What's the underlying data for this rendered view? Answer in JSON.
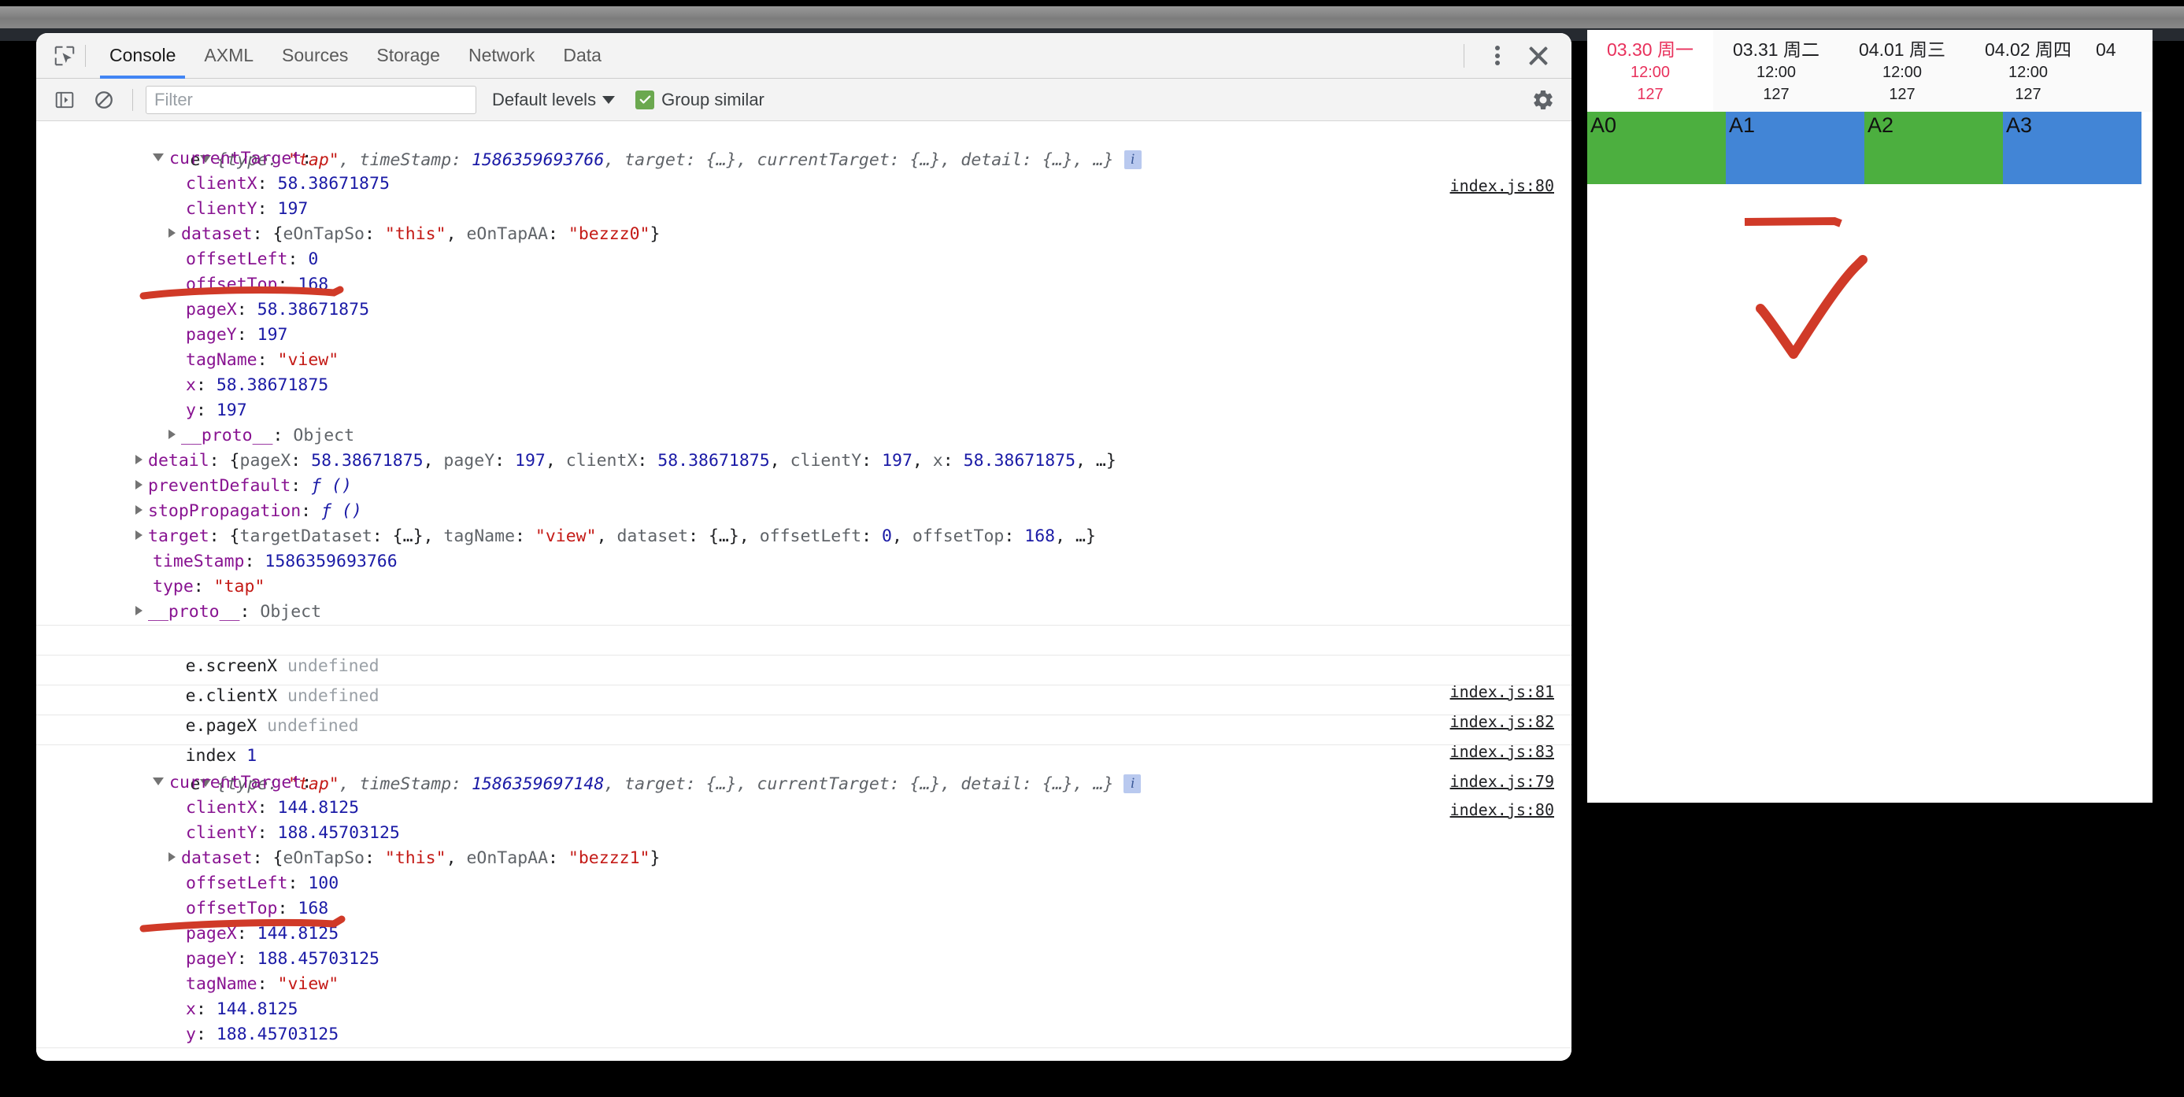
{
  "window": {
    "tabstrip": {
      "inspect_icon": "inspect-cursor-icon",
      "tabs": [
        {
          "label": "Console",
          "active": true
        },
        {
          "label": "AXML",
          "active": false
        },
        {
          "label": "Sources",
          "active": false
        },
        {
          "label": "Storage",
          "active": false
        },
        {
          "label": "Network",
          "active": false
        },
        {
          "label": "Data",
          "active": false
        }
      ],
      "more_icon": "kebab-menu-icon",
      "close_icon": "close-icon"
    },
    "toolbar": {
      "sidebar_icon": "show-console-sidebar-icon",
      "clear_icon": "clear-console-icon",
      "filter_placeholder": "Filter",
      "filter_value": "",
      "levels_label": "Default levels",
      "levels_caret": "chevron-down-icon",
      "group_similar_label": "Group similar",
      "group_similar_checked": true,
      "settings_icon": "gear-icon"
    }
  },
  "console": {
    "entries": [
      {
        "id": "entry-1",
        "source": "index.js:80",
        "header": {
          "var": "e",
          "preview": "{type: \"tap\", timeStamp: 1586359693766, target: {…}, currentTarget: {…}, detail: {…}, …}",
          "type_value": "\"tap\"",
          "timestamp_value": "1586359693766",
          "badge": "i"
        },
        "rows": [
          {
            "indent": 1,
            "arrow": "open",
            "key": "currentTarget",
            "sep": ":",
            "value": "",
            "vtype": "none"
          },
          {
            "indent": 2,
            "arrow": "none",
            "key": "clientX",
            "sep": ": ",
            "value": "58.38671875",
            "vtype": "num"
          },
          {
            "indent": 2,
            "arrow": "none",
            "key": "clientY",
            "sep": ": ",
            "value": "197",
            "vtype": "num"
          },
          {
            "indent": 2,
            "arrow": "closed",
            "key": "dataset",
            "sep": ": ",
            "value": "{eOnTapSo: \"this\", eOnTapAA: \"bezzz0\"}",
            "vtype": "objpreview",
            "strings": [
              "\"this\"",
              "\"bezzz0\""
            ]
          },
          {
            "indent": 2,
            "arrow": "none",
            "key": "offsetLeft",
            "sep": ": ",
            "value": "0",
            "vtype": "num"
          },
          {
            "indent": 2,
            "arrow": "none",
            "key": "offsetTop",
            "sep": ": ",
            "value": "168",
            "vtype": "num",
            "annotated": true
          },
          {
            "indent": 2,
            "arrow": "none",
            "key": "pageX",
            "sep": ": ",
            "value": "58.38671875",
            "vtype": "num"
          },
          {
            "indent": 2,
            "arrow": "none",
            "key": "pageY",
            "sep": ": ",
            "value": "197",
            "vtype": "num"
          },
          {
            "indent": 2,
            "arrow": "none",
            "key": "tagName",
            "sep": ": ",
            "value": "\"view\"",
            "vtype": "str"
          },
          {
            "indent": 2,
            "arrow": "none",
            "key": "x",
            "sep": ": ",
            "value": "58.38671875",
            "vtype": "num"
          },
          {
            "indent": 2,
            "arrow": "none",
            "key": "y",
            "sep": ": ",
            "value": "197",
            "vtype": "num"
          },
          {
            "indent": 2,
            "arrow": "closed",
            "key": "__proto__",
            "sep": ": ",
            "value": "Object",
            "vtype": "gray"
          },
          {
            "indent": 1,
            "arrow": "closed",
            "key": "detail",
            "sep": ": ",
            "value": "{pageX: 58.38671875, pageY: 197, clientX: 58.38671875, clientY: 197, x: 58.38671875, …}",
            "vtype": "objpreview"
          },
          {
            "indent": 1,
            "arrow": "closed",
            "key": "preventDefault",
            "sep": ": ",
            "value": "ƒ ()",
            "vtype": "fn"
          },
          {
            "indent": 1,
            "arrow": "closed",
            "key": "stopPropagation",
            "sep": ": ",
            "value": "ƒ ()",
            "vtype": "fn"
          },
          {
            "indent": 1,
            "arrow": "closed",
            "key": "target",
            "sep": ": ",
            "value": "{targetDataset: {…}, tagName: \"view\", dataset: {…}, offsetLeft: 0, offsetTop: 168, …}",
            "vtype": "objpreview"
          },
          {
            "indent": 1,
            "arrow": "none",
            "key": "timeStamp",
            "sep": ": ",
            "value": "1586359693766",
            "vtype": "num"
          },
          {
            "indent": 1,
            "arrow": "none",
            "key": "type",
            "sep": ": ",
            "value": "\"tap\"",
            "vtype": "str"
          },
          {
            "indent": 1,
            "arrow": "closed",
            "key": "__proto__",
            "sep": ": ",
            "value": "Object",
            "vtype": "gray"
          }
        ]
      },
      {
        "id": "entry-2",
        "simple": true,
        "label": "e.screenX",
        "value": "undefined",
        "source": "index.js:81"
      },
      {
        "id": "entry-3",
        "simple": true,
        "label": "e.clientX",
        "value": "undefined",
        "source": "index.js:82"
      },
      {
        "id": "entry-4",
        "simple": true,
        "label": "e.pageX",
        "value": "undefined",
        "source": "index.js:83"
      },
      {
        "id": "entry-5",
        "simple": true,
        "label": "index",
        "value": "1",
        "vtype": "num",
        "source": "index.js:79"
      },
      {
        "id": "entry-6",
        "source": "index.js:80",
        "header": {
          "var": "e",
          "preview": "{type: \"tap\", timeStamp: 1586359697148, target: {…}, currentTarget: {…}, detail: {…}, …}",
          "type_value": "\"tap\"",
          "timestamp_value": "1586359697148",
          "badge": "i"
        },
        "rows": [
          {
            "indent": 1,
            "arrow": "open",
            "key": "currentTarget",
            "sep": ":",
            "value": "",
            "vtype": "none"
          },
          {
            "indent": 2,
            "arrow": "none",
            "key": "clientX",
            "sep": ": ",
            "value": "144.8125",
            "vtype": "num"
          },
          {
            "indent": 2,
            "arrow": "none",
            "key": "clientY",
            "sep": ": ",
            "value": "188.45703125",
            "vtype": "num"
          },
          {
            "indent": 2,
            "arrow": "closed",
            "key": "dataset",
            "sep": ": ",
            "value": "{eOnTapSo: \"this\", eOnTapAA: \"bezzz1\"}",
            "vtype": "objpreview",
            "strings": [
              "\"this\"",
              "\"bezzz1\""
            ]
          },
          {
            "indent": 2,
            "arrow": "none",
            "key": "offsetLeft",
            "sep": ": ",
            "value": "100",
            "vtype": "num"
          },
          {
            "indent": 2,
            "arrow": "none",
            "key": "offsetTop",
            "sep": ": ",
            "value": "168",
            "vtype": "num",
            "annotated": true
          },
          {
            "indent": 2,
            "arrow": "none",
            "key": "pageX",
            "sep": ": ",
            "value": "144.8125",
            "vtype": "num"
          },
          {
            "indent": 2,
            "arrow": "none",
            "key": "pageY",
            "sep": ": ",
            "value": "188.45703125",
            "vtype": "num"
          },
          {
            "indent": 2,
            "arrow": "none",
            "key": "tagName",
            "sep": ": ",
            "value": "\"view\"",
            "vtype": "str"
          },
          {
            "indent": 2,
            "arrow": "none",
            "key": "x",
            "sep": ": ",
            "value": "144.8125",
            "vtype": "num"
          },
          {
            "indent": 2,
            "arrow": "none",
            "key": "y",
            "sep": ": ",
            "value": "188.45703125",
            "vtype": "num"
          }
        ]
      }
    ]
  },
  "right_panel": {
    "dates": [
      {
        "day": "03.30 周一",
        "time": "12:00",
        "count": "127",
        "selected": true
      },
      {
        "day": "03.31 周二",
        "time": "12:00",
        "count": "127",
        "selected": false
      },
      {
        "day": "04.01 周三",
        "time": "12:00",
        "count": "127",
        "selected": false
      },
      {
        "day": "04.02 周四",
        "time": "12:00",
        "count": "127",
        "selected": false
      },
      {
        "day": "04",
        "time": "",
        "count": "",
        "selected": false
      }
    ],
    "blocks": [
      {
        "label": "A0",
        "color": "#4caf3f"
      },
      {
        "label": "A1",
        "color": "#4285d6"
      },
      {
        "label": "A2",
        "color": "#4caf3f"
      },
      {
        "label": "A3",
        "color": "#4285d6"
      }
    ],
    "annotations": {
      "dash_color": "#d03a28",
      "check_color": "#d03a28"
    }
  },
  "colors": {
    "accent_blue": "#4285f4",
    "string_red": "#c41a16",
    "number_blue": "#1a1aa6",
    "property_purple": "#881391",
    "ink_red": "#d03a28",
    "selected_pink": "#e8315c",
    "block_green": "#4caf3f",
    "block_blue": "#4285d6"
  }
}
